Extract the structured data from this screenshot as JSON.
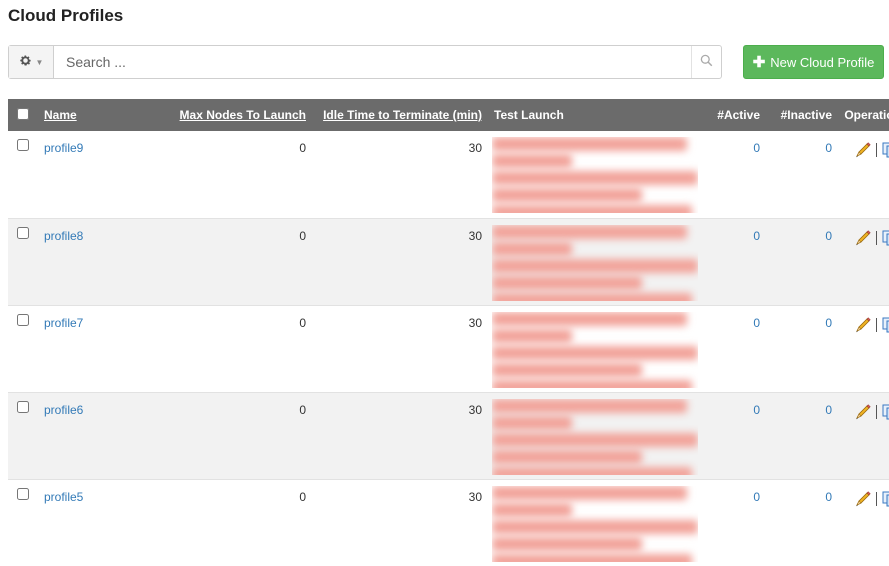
{
  "page": {
    "title": "Cloud Profiles"
  },
  "toolbar": {
    "search_placeholder": "Search ...",
    "new_button_label": "New Cloud Profile",
    "settings_icon": "gear-icon",
    "search_icon": "search-icon",
    "new_button_color": "#5cb85c"
  },
  "table": {
    "header_bg": "#6b6b6b",
    "columns": {
      "name": "Name",
      "max_nodes": "Max Nodes To Launch",
      "idle_time": "Idle Time to Terminate (min)",
      "test_launch": "Test Launch",
      "active": "#Active",
      "inactive": "#Inactive",
      "operations": "Operations"
    },
    "rows": [
      {
        "name": "profile9",
        "max_nodes": "0",
        "idle_time": "30",
        "active": "0",
        "inactive": "0"
      },
      {
        "name": "profile8",
        "max_nodes": "0",
        "idle_time": "30",
        "active": "0",
        "inactive": "0"
      },
      {
        "name": "profile7",
        "max_nodes": "0",
        "idle_time": "30",
        "active": "0",
        "inactive": "0"
      },
      {
        "name": "profile6",
        "max_nodes": "0",
        "idle_time": "30",
        "active": "0",
        "inactive": "0"
      },
      {
        "name": "profile5",
        "max_nodes": "0",
        "idle_time": "30",
        "active": "0",
        "inactive": "0"
      }
    ]
  }
}
